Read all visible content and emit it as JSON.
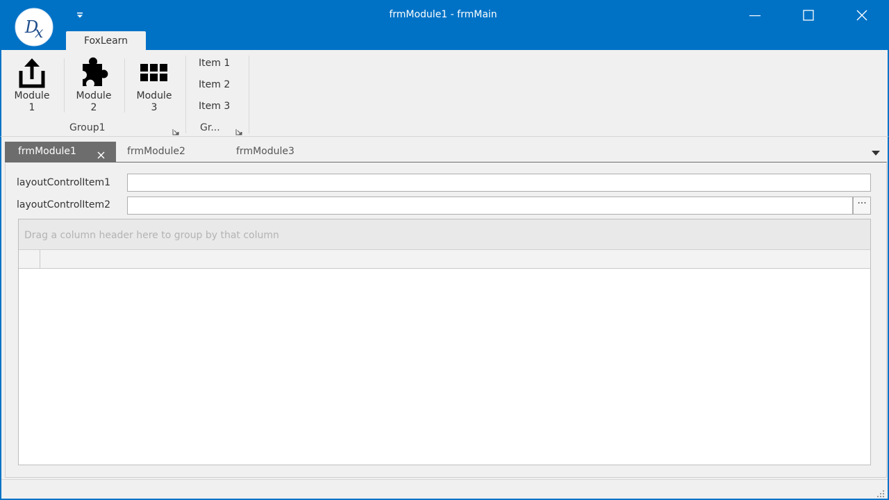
{
  "window": {
    "title": "frmModule1 - frmMain",
    "accent_color": "#0072c6",
    "logo_text": "DX",
    "controls": [
      "minimize-icon",
      "maximize-icon",
      "close-icon"
    ]
  },
  "ribbon": {
    "active_tab": "FoxLearn",
    "groups": [
      {
        "caption": "Group1",
        "buttons": [
          {
            "label_line1": "Module",
            "label_line2": "1",
            "icon": "upload-icon"
          },
          {
            "label_line1": "Module",
            "label_line2": "2",
            "icon": "puzzle-icon"
          },
          {
            "label_line1": "Module",
            "label_line2": "3",
            "icon": "grid-icon"
          }
        ]
      },
      {
        "caption": "Gr...",
        "items": [
          "Item 1",
          "Item 2",
          "Item 3"
        ]
      }
    ]
  },
  "mdi_tabs": [
    {
      "label": "frmModule1",
      "active": true
    },
    {
      "label": "frmModule2",
      "active": false
    },
    {
      "label": "frmModule3",
      "active": false
    }
  ],
  "form": {
    "field1_label": "layoutControlItem1",
    "field1_value": "",
    "field2_label": "layoutControlItem2",
    "field2_value": "",
    "ellipsis_label": "···"
  },
  "grid": {
    "group_panel_text": "Drag a column header here to group by that column"
  }
}
